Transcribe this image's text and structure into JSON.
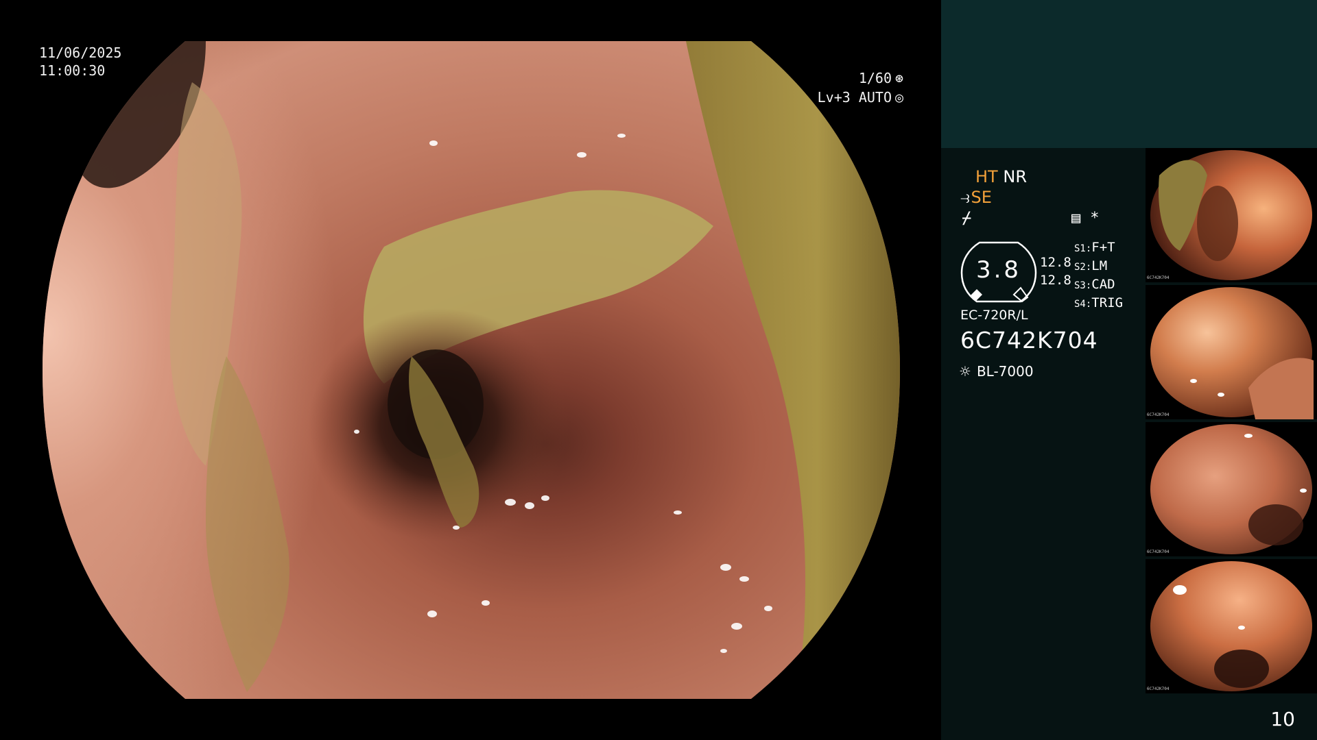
{
  "overlay": {
    "date": "11/06/2025",
    "time": "11:00:30",
    "shutter": "1/60",
    "shutter_icon": "aperture-icon",
    "level": "Lv+3 AUTO",
    "level_icon": "iris-icon"
  },
  "panel": {
    "mode_ht": "HT",
    "mode_nr": "NR",
    "mode_se": "SE",
    "nozzle_icon": "nozzle-icon",
    "flash_icon": "no-flash-icon",
    "preset_icon": "preset-list-icon",
    "star": "*",
    "gauge_value": "3.8",
    "num_top": "12.8",
    "num_bottom": "12.8",
    "slots": [
      {
        "key": "S1:",
        "value": "F+T"
      },
      {
        "key": "S2:",
        "value": "LM"
      },
      {
        "key": "S3:",
        "value": "CAD"
      },
      {
        "key": "S4:",
        "value": "TRIG"
      }
    ],
    "scope_model": "EC-720R/L",
    "serial": "6C742K704",
    "light_source": "BL-7000",
    "light_icon": "sun-icon"
  },
  "thumbnails": [
    {
      "caption": "6C742K704"
    },
    {
      "caption": "6C742K704"
    },
    {
      "caption": "6C742K704"
    },
    {
      "caption": "6C742K704"
    }
  ],
  "page_number": "10",
  "colors": {
    "panel_bg": "#061313",
    "panel_top": "#0c2a2b",
    "accent_orange": "#f3a13a",
    "mucosa": "#b56a4f",
    "debris": "#b9aa55"
  }
}
